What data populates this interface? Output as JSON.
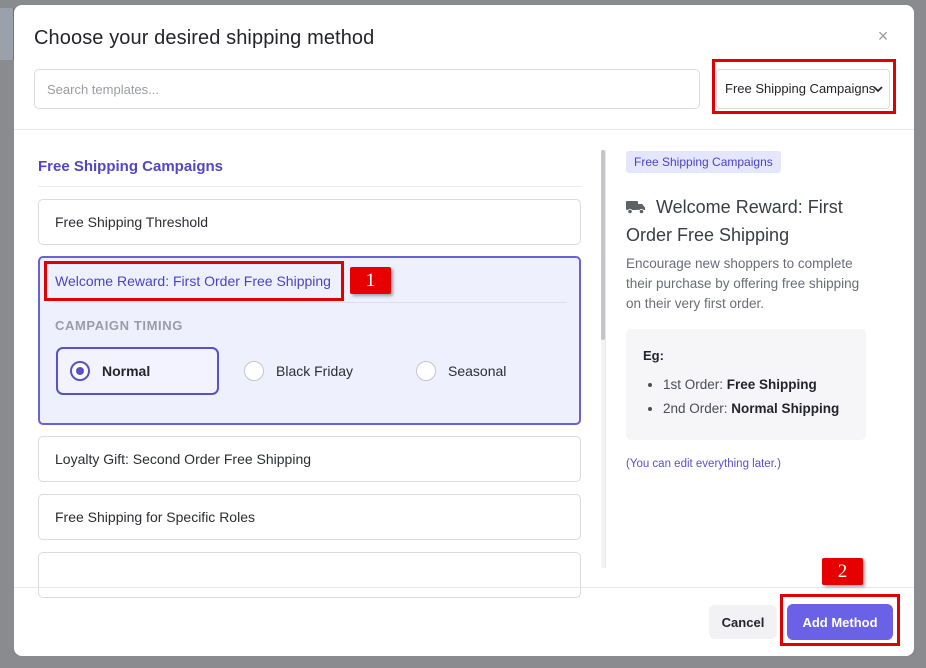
{
  "modal": {
    "title": "Choose your desired shipping method",
    "close_glyph": "×"
  },
  "search": {
    "placeholder": "Search templates...",
    "value": ""
  },
  "category_select": {
    "selected": "Free Shipping Campaigns"
  },
  "list": {
    "section_title": "Free Shipping Campaigns",
    "items": [
      {
        "label": "Free Shipping Threshold"
      },
      {
        "label": "Welcome Reward: First Order Free Shipping",
        "selected": true
      },
      {
        "label": "Loyalty Gift: Second Order Free Shipping"
      },
      {
        "label": "Free Shipping for Specific Roles"
      },
      {
        "label": ""
      }
    ],
    "timing": {
      "heading": "CAMPAIGN TIMING",
      "options": [
        "Normal",
        "Black Friday",
        "Seasonal"
      ],
      "selected": "Normal"
    }
  },
  "detail": {
    "badge": "Free Shipping Campaigns",
    "icon": "truck-icon",
    "title": "Welcome Reward: First Order Free Shipping",
    "description": "Encourage new shoppers to complete their purchase by offering free shipping on their very first order.",
    "example": {
      "label": "Eg:",
      "lines": [
        {
          "prefix": "1st Order: ",
          "value": "Free Shipping"
        },
        {
          "prefix": "2nd Order: ",
          "value": "Normal Shipping"
        }
      ]
    },
    "note": "(You can edit everything later.)"
  },
  "footer": {
    "cancel_label": "Cancel",
    "add_label": "Add Method"
  },
  "annotations": {
    "marker_1": "1",
    "marker_2": "2"
  },
  "colors": {
    "accent": "#6a61e6",
    "accent_text": "#5146c8",
    "selected_bg": "#eef0fe",
    "annotation_red": "#e00000"
  }
}
